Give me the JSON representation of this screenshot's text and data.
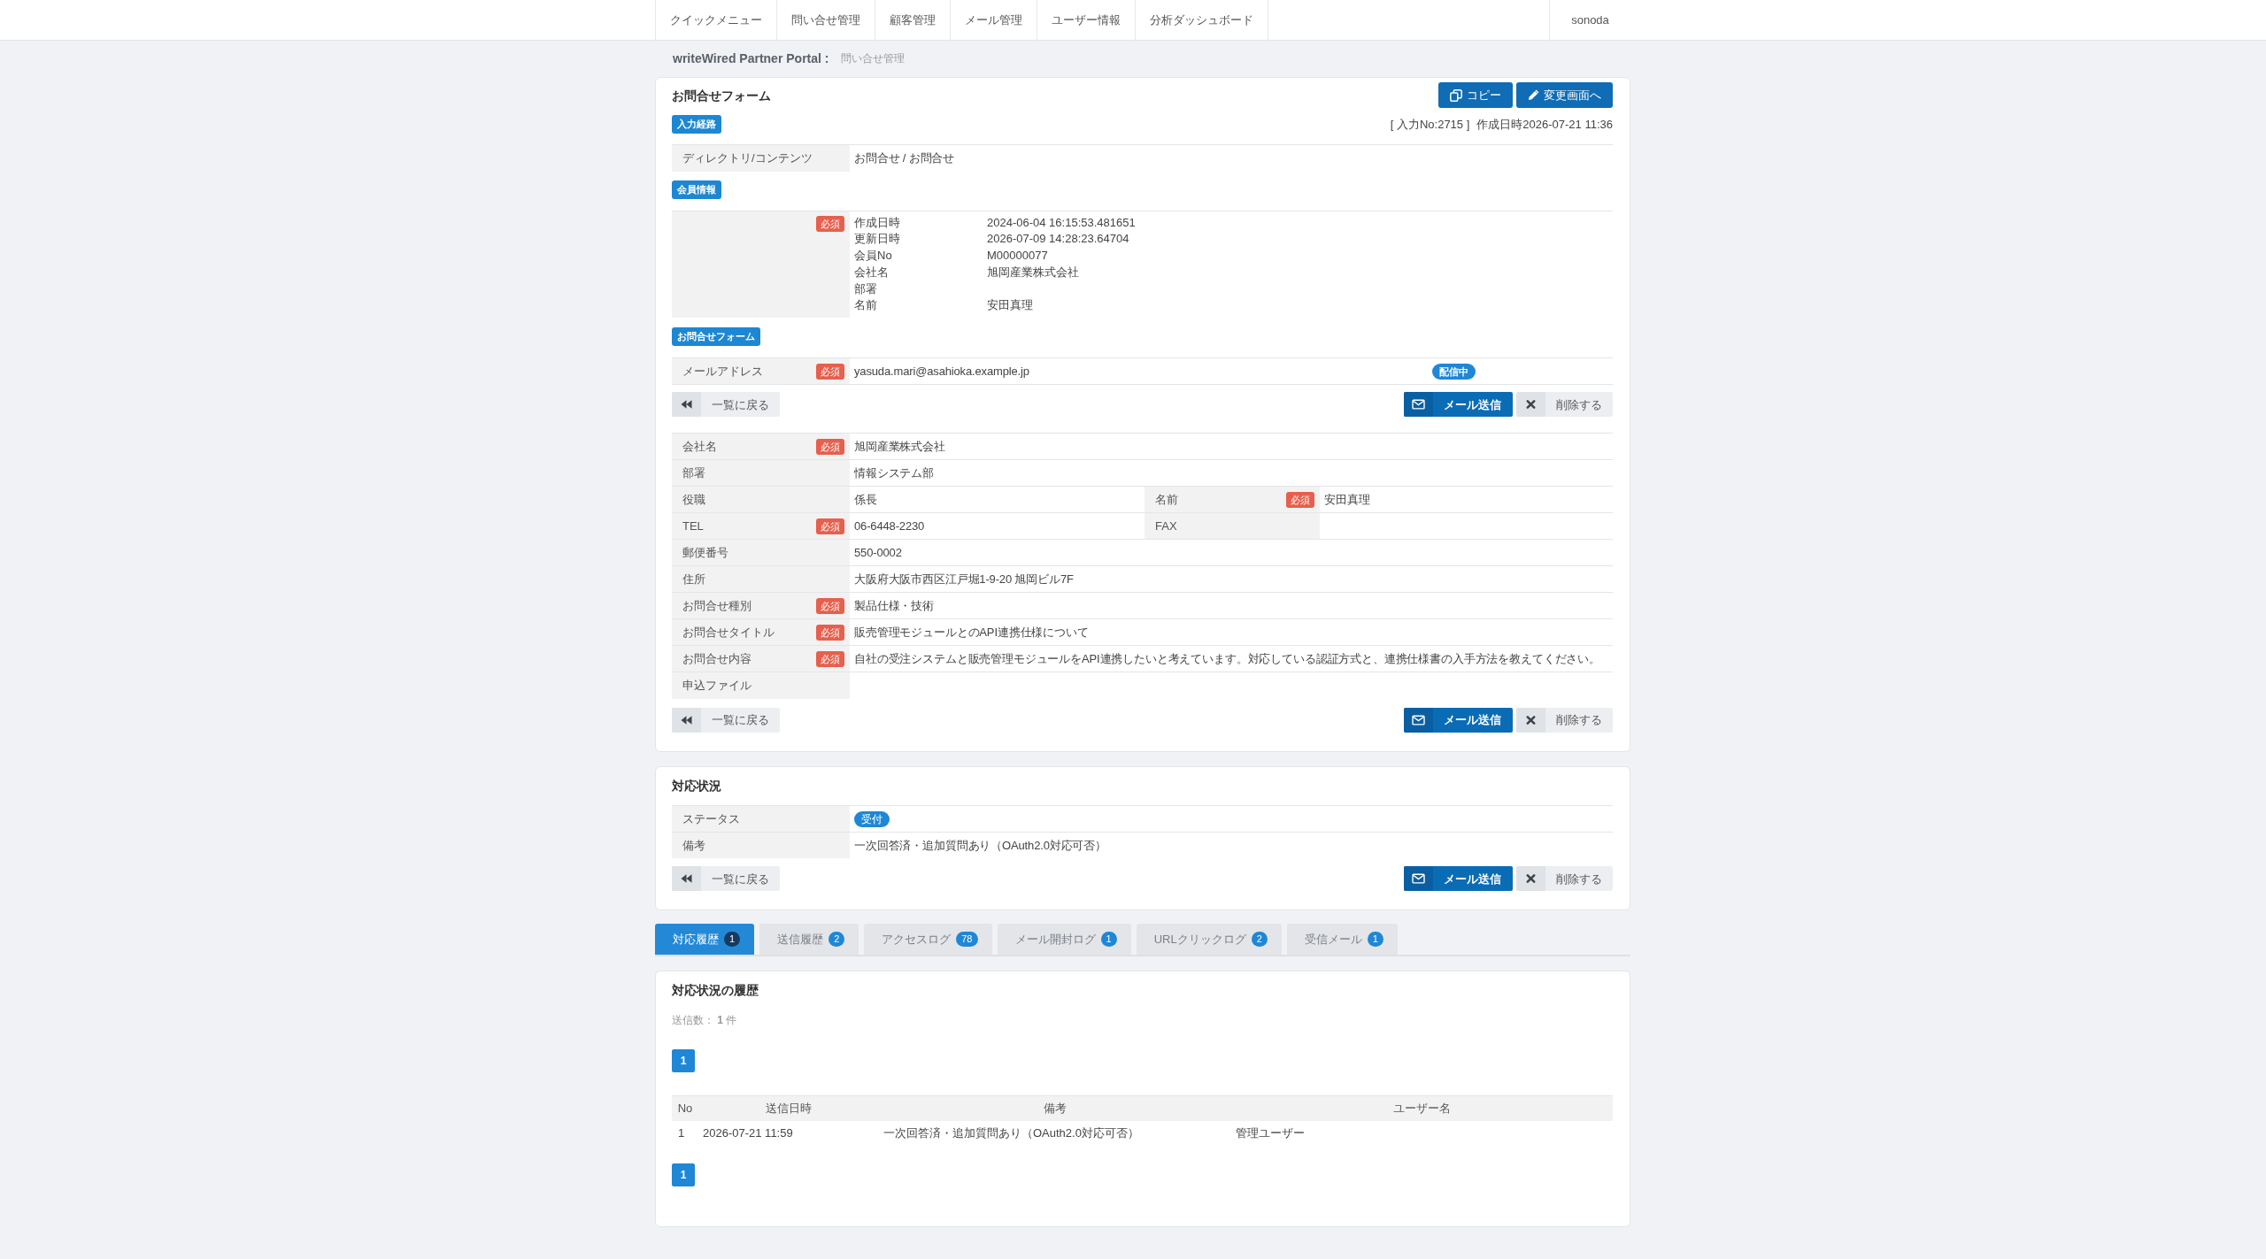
{
  "navbar": {
    "menu": [
      {
        "label": "クイックメニュー"
      },
      {
        "label": "問い合せ管理"
      },
      {
        "label": "顧客管理"
      },
      {
        "label": "メール管理"
      },
      {
        "label": "ユーザー情報"
      },
      {
        "label": "分析ダッシュボード"
      }
    ],
    "user": "sonoda"
  },
  "breadcrumb": {
    "site": "writeWired Partner Portal :",
    "page": "問い合せ管理"
  },
  "inquiry_form": {
    "title": "お問合せフォーム",
    "header_buttons": [
      {
        "kind": "copy",
        "label": "コピー"
      },
      {
        "kind": "edit",
        "label": "変更画面へ"
      }
    ],
    "source": {
      "tag": "入力経路",
      "entry_no": "[ 入力No:2715 ]",
      "created": "作成日時2026-07-21 11:36",
      "rows": [
        {
          "label": "ディレクトリ/コンテンツ",
          "value": "お問合せ / お問合せ"
        }
      ]
    },
    "member": {
      "tag": "会員情報",
      "required_badge": "必須",
      "fields": [
        {
          "label": "作成日時",
          "value": "2024-06-04 16:15:53.481651"
        },
        {
          "label": "更新日時",
          "value": "2026-07-09 14:28:23.64704"
        },
        {
          "label": "会員No",
          "value": "M00000077"
        },
        {
          "label": "会社名",
          "value": "旭岡産業株式会社"
        },
        {
          "label": "部署"
        },
        {
          "label": "名前",
          "value": "安田真理"
        }
      ]
    },
    "form": {
      "tag": "お問合せフォーム",
      "email": {
        "label": "メールアドレス",
        "required_badge": "必須",
        "value": "yasuda.mari@asahioka.example.jp",
        "status": "配信中"
      }
    },
    "actions_top": [
      {
        "kind": "back",
        "label": "一覧に戻る"
      },
      {
        "kind": "mail",
        "label": "メール送信"
      },
      {
        "kind": "delete",
        "label": "削除する"
      }
    ],
    "fields": [
      {
        "cells": [
          {
            "label": "会社名",
            "required_badge": "必須",
            "value": "旭岡産業株式会社"
          }
        ]
      },
      {
        "cells": [
          {
            "label": "部署",
            "value": "情報システム部"
          }
        ]
      },
      {
        "cells": [
          {
            "label": "役職",
            "value": "係長"
          },
          {
            "label": "名前",
            "required_badge": "必須",
            "value": "安田真理"
          }
        ]
      },
      {
        "cells": [
          {
            "label": "TEL",
            "required_badge": "必須",
            "value": "06-6448-2230"
          },
          {
            "label": "FAX"
          }
        ]
      },
      {
        "cells": [
          {
            "label": "郵便番号",
            "value": "550-0002"
          }
        ]
      },
      {
        "cells": [
          {
            "label": "住所",
            "value": "大阪府大阪市西区江戸堀1-9-20 旭岡ビル7F"
          }
        ]
      },
      {
        "cells": [
          {
            "label": "お問合せ種別",
            "required_badge": "必須",
            "value": "製品仕様・技術"
          }
        ]
      },
      {
        "cells": [
          {
            "label": "お問合せタイトル",
            "required_badge": "必須",
            "value": "販売管理モジュールとのAPI連携仕様について"
          }
        ]
      },
      {
        "cells": [
          {
            "label": "お問合せ内容",
            "required_badge": "必須",
            "value": "自社の受注システムと販売管理モジュールをAPI連携したいと考えています。対応している認証方式と、連携仕様書の入手方法を教えてください。"
          }
        ]
      },
      {
        "cells": [
          {
            "label": "申込ファイル"
          }
        ]
      }
    ],
    "actions_bottom": [
      {
        "kind": "back",
        "label": "一覧に戻る"
      },
      {
        "kind": "mail",
        "label": "メール送信"
      },
      {
        "kind": "delete",
        "label": "削除する"
      }
    ]
  },
  "response_status": {
    "title": "対応状況",
    "rows": [
      {
        "kind": "pill",
        "label": "ステータス",
        "value": "受付"
      },
      {
        "kind": "text",
        "label": "備考",
        "value": "一次回答済・追加質問あり（OAuth2.0対応可否）"
      }
    ],
    "actions": [
      {
        "kind": "back",
        "label": "一覧に戻る"
      },
      {
        "kind": "mail",
        "label": "メール送信"
      },
      {
        "kind": "delete",
        "label": "削除する"
      }
    ]
  },
  "tabs": [
    {
      "label": "対応履歴",
      "count": "1",
      "selected": true
    },
    {
      "label": "送信履歴",
      "count": "2",
      "selected": false
    },
    {
      "label": "アクセスログ",
      "count": "78",
      "selected": false
    },
    {
      "label": "メール開封ログ",
      "count": "1",
      "selected": false
    },
    {
      "label": "URLクリックログ",
      "count": "2",
      "selected": false
    },
    {
      "label": "受信メール",
      "count": "1",
      "selected": false
    }
  ],
  "history": {
    "title": "対応状況の履歴",
    "summary": "送信数： **1** 件",
    "pagination_top": [
      {
        "label": "1",
        "selected": true
      }
    ],
    "table": {
      "columns": [
        "No",
        "送信日時",
        "備考",
        "ユーザー名"
      ],
      "rows": [
        [
          "1",
          "2026-07-21 11:59",
          "一次回答済・追加質問あり（OAuth2.0対応可否）",
          "管理ユーザー"
        ]
      ]
    },
    "pagination_bottom": [
      {
        "label": "1",
        "selected": true
      }
    ]
  }
}
